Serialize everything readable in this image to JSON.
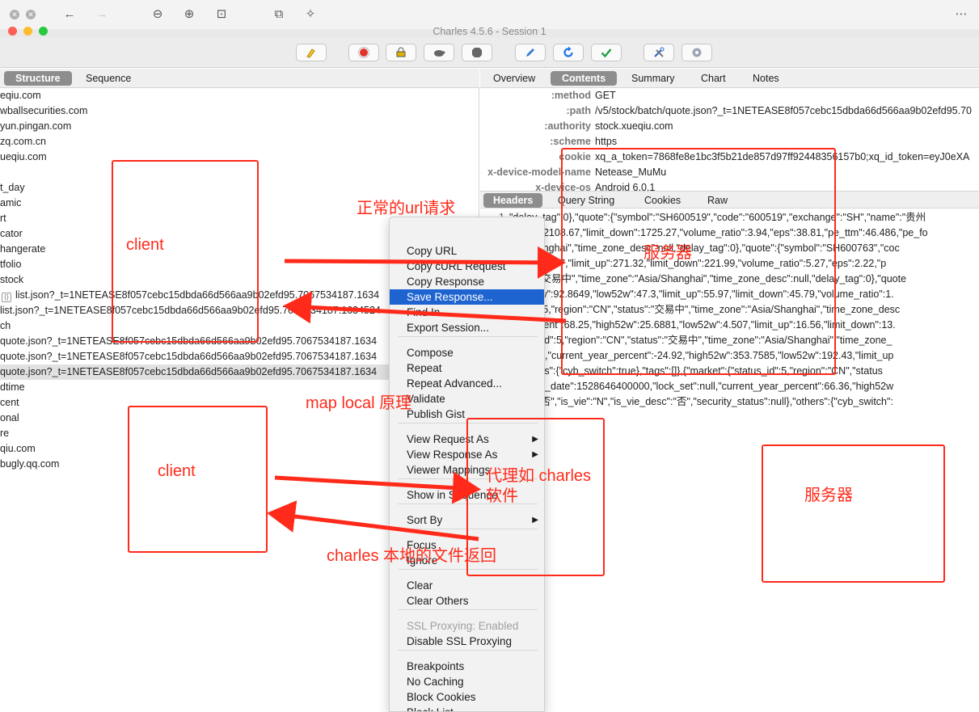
{
  "window": {
    "title": "Charles 4.5.6 - Session 1"
  },
  "viewer_icons": [
    "close-icon",
    "close-icon",
    "back-arrow-icon",
    "forward-arrow-icon",
    "zoom-out-icon",
    "zoom-in-icon",
    "fit-icon",
    "rotate-icon",
    "magic-wand-icon",
    "more-icon"
  ],
  "toolbar": {
    "buttons": [
      "broom-icon",
      "record-icon",
      "throttle-icon",
      "turtle-icon",
      "stop-icon",
      "pen-icon",
      "refresh-icon",
      "check-icon",
      "tools-icon",
      "gear-icon"
    ]
  },
  "left": {
    "tabs": {
      "structure": "Structure",
      "sequence": "Sequence"
    },
    "rows": [
      "eqiu.com",
      "wballsecurities.com",
      "yun.pingan.com",
      "zq.com.cn",
      "ueqiu.com",
      "",
      "t_day",
      "amic",
      "rt",
      "cator",
      "hangerate",
      "tfolio",
      "stock",
      "list.json?_t=1NETEASE8f057cebc15dbda66d566aa9b02efd95.7067534187.1634",
      "list.json?_t=1NETEASE8f057cebc15dbda66d566aa9b02efd95.7067534187.1634524",
      "ch",
      "quote.json?_t=1NETEASE8f057cebc15dbda66d566aa9b02efd95.7067534187.1634",
      "quote.json?_t=1NETEASE8f057cebc15dbda66d566aa9b02efd95.7067534187.1634",
      "quote.json?_t=1NETEASE8f057cebc15dbda66d566aa9b02efd95.7067534187.1634",
      "dtime",
      "cent",
      "onal",
      "re",
      "qiu.com",
      "bugly.qq.com"
    ]
  },
  "right": {
    "tabs": {
      "overview": "Overview",
      "contents": "Contents",
      "summary": "Summary",
      "chart": "Chart",
      "notes": "Notes"
    },
    "headers": [
      {
        "k": ":method",
        "v": "GET"
      },
      {
        "k": ":path",
        "v": "/v5/stock/batch/quote.json?_t=1NETEASE8f057cebc15dbda66d566aa9b02efd95.70"
      },
      {
        "k": ":authority",
        "v": "stock.xueqiu.com"
      },
      {
        "k": ":scheme",
        "v": "https"
      },
      {
        "k": "cookie",
        "v": "xq_a_token=7868fe8e1bc3f5b21de857d97ff92448356157b0;xq_id_token=eyJ0eXA"
      },
      {
        "k": "x-device-model-name",
        "v": "Netease_MuMu"
      },
      {
        "k": "x-device-os",
        "v": "Android 6.0.1"
      }
    ],
    "subtabs": {
      "headers": "Headers",
      "query": "Query String",
      "cookies": "Cookies",
      "raw": "Raw"
    },
    "line_no": "1",
    "body": [
      "\"delay_tag\":0},\"quote\":{\"symbol\":\"SH600519\",\"code\":\"600519\",\"exchange\":\"SH\",\"name\":\"贵州",
      "nit_up\":2108.67,\"limit_down\":1725.27,\"volume_ratio\":3.94,\"eps\":38.81,\"pe_ttm\":46.486,\"pe_fo",
      "sia/Shanghai\",\"time_zone_desc\":null,\"delay_tag\":0},\"quote\":{\"symbol\":\"SH600763\",\"coc",
      "h52w\":200.7,\"limit_up\":271.32,\"limit_down\":221.99,\"volume_ratio\":5.27,\"eps\":2.22,\"p",
      "tatus\":\"交易中\",\"time_zone\":\"Asia/Shanghai\",\"time_zone_desc\":null,\"delay_tag\":0},\"quote",
      "high52w\":92.8649,\"low52w\":47.3,\"limit_up\":55.97,\"limit_down\":45.79,\"volume_ratio\":1.",
      "tus_id\":5,\"region\":\"CN\",\"status\":\"交易中\",\"time_zone\":\"Asia/Shanghai\",\"time_zone_desc",
      "ar_percent\":68.25,\"high52w\":25.6881,\"low52w\":4.507,\"limit_up\":16.56,\"limit_down\":13.",
      "status_id\":5,\"region\":\"CN\",\"status\":\"交易中\",\"time_zone\":\"Asia/Shanghai\",\"time_zone_",
      "set\":null,\"current_year_percent\":-24.92,\"high52w\":353.7585,\"low52w\":192.43,\"limit_up",
      "l},\"others\":{\"cyb_switch\":true},\"tags\":[]},{\"market\":{\"status_id\":5,\"region\":\"CN\",\"status",
      "2,\"issue_date\":1528646400000,\"lock_set\":null,\"current_year_percent\":66.36,\"high52w",
      "desc\":\"否\",\"is_vie\":\"N\",\"is_vie_desc\":\"否\",\"security_status\":null},\"others\":{\"cyb_switch\":"
    ]
  },
  "menu": {
    "items": [
      {
        "label": "Copy URL"
      },
      {
        "label": "Copy cURL Request"
      },
      {
        "label": "Copy Response"
      },
      {
        "label": "Save Response...",
        "highlight": true
      },
      {
        "label": "Find In"
      },
      {
        "label": "Export Session..."
      },
      {
        "label": "Compose"
      },
      {
        "label": "Repeat"
      },
      {
        "label": "Repeat Advanced..."
      },
      {
        "label": "Validate"
      },
      {
        "label": "Publish Gist"
      },
      {
        "label": "View Request As",
        "submenu": true
      },
      {
        "label": "View Response As",
        "submenu": true
      },
      {
        "label": "Viewer Mappings"
      },
      {
        "label": "Show in Sequence"
      },
      {
        "label": "Sort By",
        "submenu": true
      },
      {
        "label": "Focus"
      },
      {
        "label": "Ignore"
      },
      {
        "label": "Clear"
      },
      {
        "label": "Clear Others"
      },
      {
        "label": "SSL Proxying: Enabled",
        "disabled": true
      },
      {
        "label": "Disable SSL Proxying"
      },
      {
        "label": "Breakpoints"
      },
      {
        "label": "No Caching"
      },
      {
        "label": "Block Cookies"
      },
      {
        "label": "Block List"
      }
    ],
    "submenu_glyph": "▶"
  },
  "annotations": {
    "client_top": "client",
    "client_bottom": "client",
    "normal_request": "正常的url请求",
    "server_top": "服务器",
    "map_local": "map local 原理",
    "proxy_line1": "代理如 charles",
    "proxy_line2": "软件",
    "server_right": "服务器",
    "charles_local": "charles 本地的文件返回",
    "color": "#ff2a1a"
  }
}
